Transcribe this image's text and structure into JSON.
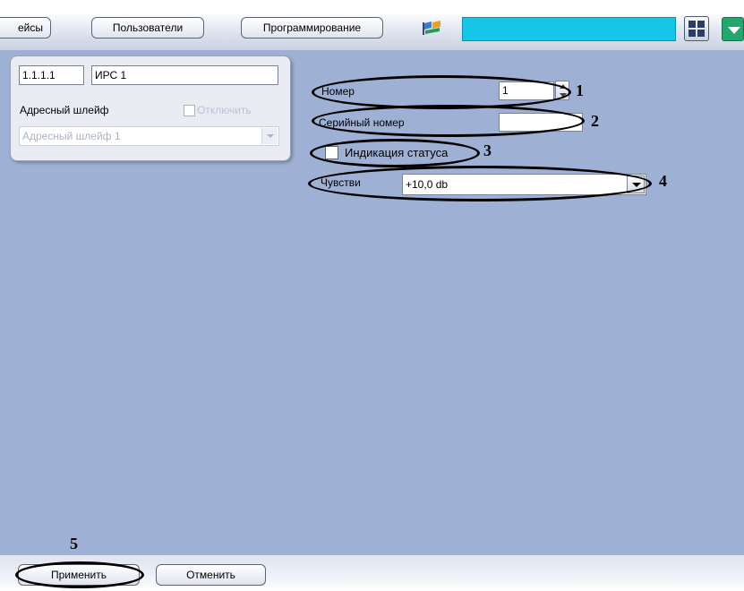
{
  "toolbar": {
    "btn_interfaces": "ейсы",
    "btn_users": "Пользователи",
    "btn_programming": "Программирование",
    "flag_icon": "flag-icon",
    "grid_icon": "grid-layout-icon",
    "dropdown_icon": "chevron-down-icon",
    "accent_color": "#16c6e8"
  },
  "device": {
    "address": "1.1.1.1",
    "name": "ИРС 1",
    "loop_label": "Адресный шлейф",
    "disable_label": "Отключить",
    "loop_value": "Адресный шлейф 1"
  },
  "form": {
    "number_label": "Номер",
    "number_value": "1",
    "serial_label": "Серийный номер",
    "serial_value": "",
    "status_label": "Индикация статуса",
    "sens_label": "Чувстви",
    "sens_value": "+10,0 db"
  },
  "callouts": {
    "c1": "1",
    "c2": "2",
    "c3": "3",
    "c4": "4",
    "c5": "5"
  },
  "footer": {
    "apply": "Применить",
    "cancel": "Отменить"
  },
  "colors": {
    "panel_bg": "#9eb0d3",
    "card_bg": "#e9ecf3"
  }
}
